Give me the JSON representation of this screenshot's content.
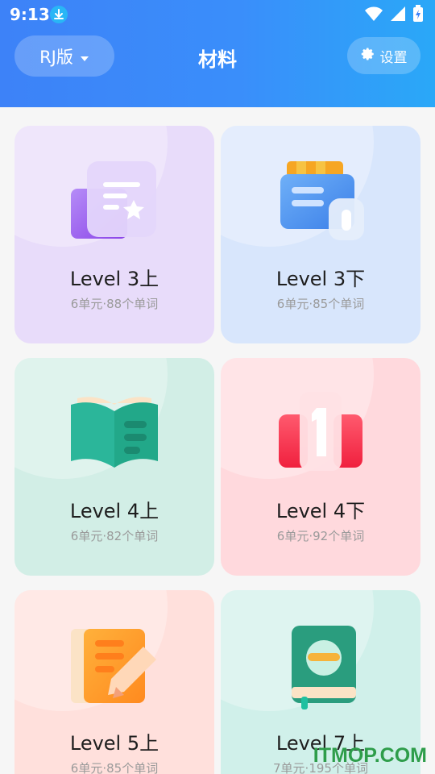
{
  "status_bar": {
    "time": "9:13"
  },
  "header": {
    "version_label": "RJ版",
    "title": "材料",
    "settings_label": "设置"
  },
  "cards": [
    {
      "name": "Level 3上",
      "meta": "6单元·88个单词",
      "bg": "#e8dcfa",
      "icon": "folder-star-icon"
    },
    {
      "name": "Level 3下",
      "meta": "6单元·85个单词",
      "bg": "#d8e6fc",
      "icon": "card-wallet-icon"
    },
    {
      "name": "Level 4上",
      "meta": "6单元·82个单词",
      "bg": "#d2eee6",
      "icon": "open-book-icon"
    },
    {
      "name": "Level 4下",
      "meta": "6单元·92个单词",
      "bg": "#ffd9dd",
      "icon": "ranking-one-icon"
    },
    {
      "name": "Level 5上",
      "meta": "6单元·85个单词",
      "bg": "#ffe0dc",
      "icon": "notebook-pencil-icon"
    },
    {
      "name": "Level 7上",
      "meta": "7单元·195个单词",
      "bg": "#d0f0ea",
      "icon": "closed-book-icon"
    }
  ],
  "watermark": "ITMOP.COM",
  "colors": {
    "header_start": "#3d82f8",
    "header_end": "#2aa8f8",
    "page_bg": "#f6f6f6"
  }
}
